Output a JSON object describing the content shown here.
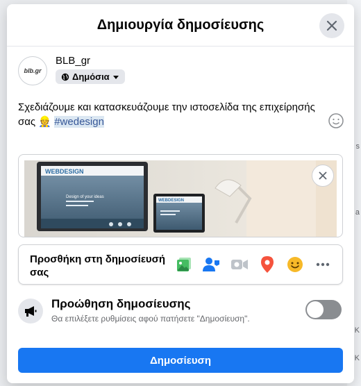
{
  "dialog": {
    "title": "Δημιουργία δημοσίευσης"
  },
  "author": {
    "name": "BLB_gr",
    "avatar_text": "blb.gr",
    "audience_label": "Δημόσια"
  },
  "post": {
    "text_main": "Σχεδιάζουμε και κατασκευάζουμε την ιστοσελίδα της επιχείρησής σας",
    "emoji": "👷",
    "hashtag": "#wedesign"
  },
  "attachment": {
    "screen_logo": "WEBDESIGN",
    "screen_logo_small": "WEBDESIGN",
    "screen_tagline": "Design of your ideas"
  },
  "add_to_post": {
    "label": "Προσθήκη στη δημοσίευσή σας",
    "icons": [
      "photo-video-icon",
      "tag-people-icon",
      "live-video-icon",
      "check-in-icon",
      "feeling-icon",
      "more-icon"
    ]
  },
  "boost": {
    "title": "Προώθηση δημοσίευσης",
    "subtitle": "Θα επιλέξετε ρυθμίσεις αφού πατήσετε \"Δημοσίευση\".",
    "enabled": false
  },
  "actions": {
    "post_label": "Δημοσίευση"
  },
  "background": {
    "frag_1": "s",
    "frag_2": "a",
    "frag_3": "K",
    "frag_4": "K"
  },
  "colors": {
    "primary": "#1877f2",
    "hashtag_bg": "#dbe7f2",
    "hashtag_text": "#385898"
  }
}
